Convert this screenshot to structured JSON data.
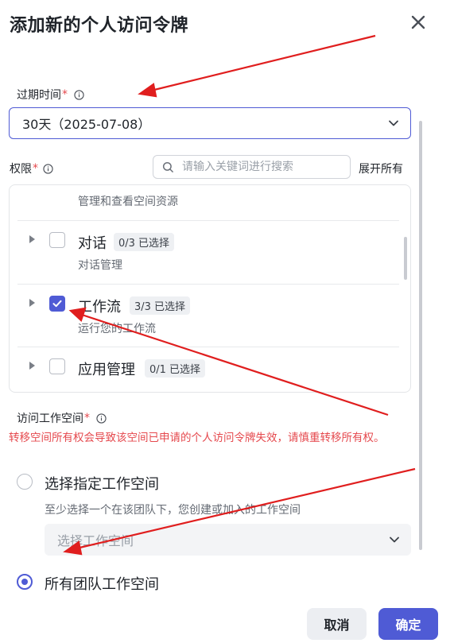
{
  "dialog": {
    "title": "添加新的个人访问令牌"
  },
  "expiration": {
    "label": "过期时间",
    "required_mark": "*",
    "selected": "30天（2025-07-08）"
  },
  "permissions": {
    "label": "权限",
    "required_mark": "*",
    "search_placeholder": "请输入关键词进行搜索",
    "expand_all": "展开所有",
    "top_description": "管理和查看空间资源",
    "items": [
      {
        "name": "对话",
        "badge": "0/3 已选择",
        "description": "对话管理",
        "checked": false
      },
      {
        "name": "工作流",
        "badge": "3/3 已选择",
        "description": "运行您的工作流",
        "checked": true
      },
      {
        "name": "应用管理",
        "badge": "0/1 已选择",
        "description": "",
        "checked": false
      }
    ]
  },
  "workspace": {
    "label": "访问工作空间",
    "required_mark": "*",
    "warning": "转移空间所有权会导致该空间已申请的个人访问令牌失效，请慎重转移所有权。",
    "option_specific": "选择指定工作空间",
    "option_specific_hint": "至少选择一个在该团队下，您创建或加入的工作空间",
    "select_placeholder": "选择工作空间",
    "option_all": "所有团队工作空间",
    "selected_option": "所有团队工作空间"
  },
  "footer": {
    "cancel": "取消",
    "confirm": "确定"
  },
  "colors": {
    "accent": "#4f5bd5",
    "warning": "#e5484d",
    "annotation_arrow": "#e01e1e"
  }
}
